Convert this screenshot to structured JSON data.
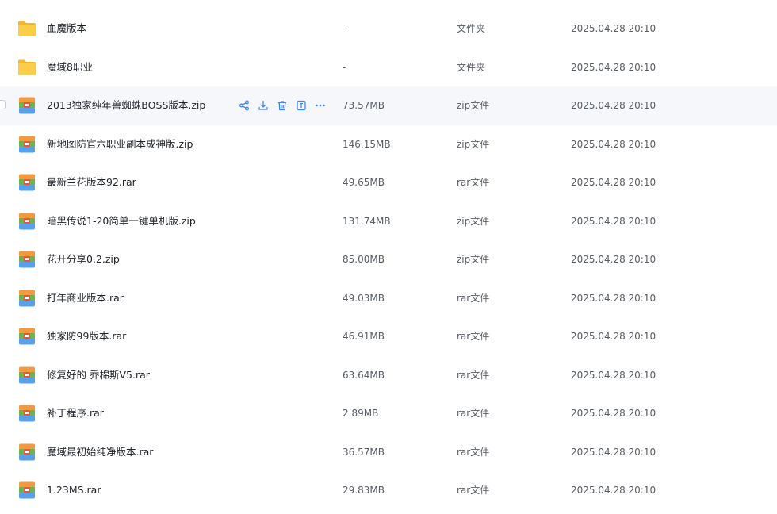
{
  "files": [
    {
      "icon": "folder-icon",
      "name": "血魔版本",
      "size": "-",
      "type": "文件夹",
      "date": "2025.04.28 20:10"
    },
    {
      "icon": "folder-icon",
      "name": "魔域8职业",
      "size": "-",
      "type": "文件夹",
      "date": "2025.04.28 20:10"
    },
    {
      "icon": "archive-icon",
      "name": "2013独家纯年兽蜘蛛BOSS版本.zip",
      "size": "73.57MB",
      "type": "zip文件",
      "date": "2025.04.28 20:10"
    },
    {
      "icon": "archive-icon",
      "name": "新地图防官六职业副本成神版.zip",
      "size": "146.15MB",
      "type": "zip文件",
      "date": "2025.04.28 20:10"
    },
    {
      "icon": "archive-icon",
      "name": "最新兰花版本92.rar",
      "size": "49.65MB",
      "type": "rar文件",
      "date": "2025.04.28 20:10"
    },
    {
      "icon": "archive-icon",
      "name": "暗黑传说1-20简单一键单机版.zip",
      "size": "131.74MB",
      "type": "zip文件",
      "date": "2025.04.28 20:10"
    },
    {
      "icon": "archive-icon",
      "name": "花开分享0.2.zip",
      "size": "85.00MB",
      "type": "zip文件",
      "date": "2025.04.28 20:10"
    },
    {
      "icon": "archive-icon",
      "name": "打年商业版本.rar",
      "size": "49.03MB",
      "type": "rar文件",
      "date": "2025.04.28 20:10"
    },
    {
      "icon": "archive-icon",
      "name": "独家防99版本.rar",
      "size": "46.91MB",
      "type": "rar文件",
      "date": "2025.04.28 20:10"
    },
    {
      "icon": "archive-icon",
      "name": "修复好的 乔棉斯V5.rar",
      "size": "63.64MB",
      "type": "rar文件",
      "date": "2025.04.28 20:10"
    },
    {
      "icon": "archive-icon",
      "name": "补丁程序.rar",
      "size": "2.89MB",
      "type": "rar文件",
      "date": "2025.04.28 20:10"
    },
    {
      "icon": "archive-icon",
      "name": "魔域最初始纯净版本.rar",
      "size": "36.57MB",
      "type": "rar文件",
      "date": "2025.04.28 20:10"
    },
    {
      "icon": "archive-icon",
      "name": "1.23MS.rar",
      "size": "29.83MB",
      "type": "rar文件",
      "date": "2025.04.28 20:10"
    }
  ],
  "hovered_row_index": 2,
  "row_actions": [
    "share-icon",
    "download-icon",
    "delete-icon",
    "rename-icon",
    "more-icon"
  ],
  "colors": {
    "folder": "#f9c43a",
    "action": "#3b87f7",
    "hover_background": "#f5f7fb",
    "text_primary": "#1f2329",
    "text_secondary": "#585d66"
  }
}
